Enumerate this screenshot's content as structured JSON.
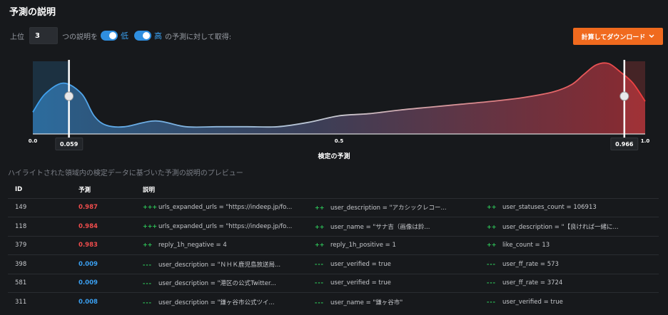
{
  "title": "予測の説明",
  "controls": {
    "prefix": "上位",
    "count_value": "3",
    "mid_text": "つの説明を",
    "low_label": "低",
    "high_label": "高",
    "suffix": "の予測に対して取得:",
    "download_label": "計算してダウンロード"
  },
  "chart_data": {
    "type": "area",
    "xlabel": "検定の予測",
    "xlim": [
      0,
      1
    ],
    "ticks": [
      "0.0",
      "0.5",
      "1.0"
    ],
    "low_threshold": 0.059,
    "high_threshold": 0.966,
    "low_threshold_label": "0.059",
    "high_threshold_label": "0.966",
    "x": [
      0,
      0.02,
      0.05,
      0.08,
      0.1,
      0.12,
      0.15,
      0.2,
      0.25,
      0.3,
      0.35,
      0.4,
      0.45,
      0.5,
      0.55,
      0.6,
      0.65,
      0.7,
      0.75,
      0.8,
      0.85,
      0.88,
      0.9,
      0.92,
      0.94,
      0.96,
      0.98,
      1.0
    ],
    "y": [
      0.3,
      0.55,
      0.7,
      0.55,
      0.25,
      0.12,
      0.1,
      0.18,
      0.1,
      0.1,
      0.1,
      0.1,
      0.16,
      0.25,
      0.28,
      0.33,
      0.37,
      0.41,
      0.45,
      0.5,
      0.58,
      0.68,
      0.82,
      0.95,
      0.97,
      0.85,
      0.7,
      0.45
    ]
  },
  "preview_note": "ハイライトされた領域内の検定データに基づいた予測の説明のプレビュー",
  "table": {
    "headers": [
      "ID",
      "予測",
      "説明"
    ],
    "rows": [
      {
        "id": "149",
        "pred": "0.987",
        "level": "high",
        "expl": [
          {
            "sign": "+++",
            "text": "urls_expanded_urls = \"https://indeep.jp/fo..."
          },
          {
            "sign": "++",
            "text": "user_description = \"アカシックレコー..."
          },
          {
            "sign": "++",
            "text": "user_statuses_count = 106913"
          }
        ]
      },
      {
        "id": "118",
        "pred": "0.984",
        "level": "high",
        "expl": [
          {
            "sign": "+++",
            "text": "urls_expanded_urls = \"https://indeep.jp/fo..."
          },
          {
            "sign": "++",
            "text": "user_name = \"サナ吉（画像は鈴..."
          },
          {
            "sign": "++",
            "text": "user_description = \"【良ければ一緒に..."
          }
        ]
      },
      {
        "id": "379",
        "pred": "0.983",
        "level": "high",
        "expl": [
          {
            "sign": "++",
            "text": "reply_1h_negative = 4"
          },
          {
            "sign": "++",
            "text": "reply_1h_positive = 1"
          },
          {
            "sign": "++",
            "text": "like_count = 13"
          }
        ]
      },
      {
        "id": "398",
        "pred": "0.009",
        "level": "low",
        "expl": [
          {
            "sign": "---",
            "text": "user_description = \"ＮＨＫ鹿児島放送局..."
          },
          {
            "sign": "---",
            "text": "user_verified = true"
          },
          {
            "sign": "---",
            "text": "user_ff_rate = 573"
          }
        ]
      },
      {
        "id": "581",
        "pred": "0.009",
        "level": "low",
        "expl": [
          {
            "sign": "---",
            "text": "user_description = \"港区の公式Twitter..."
          },
          {
            "sign": "---",
            "text": "user_verified = true"
          },
          {
            "sign": "---",
            "text": "user_ff_rate = 3724"
          }
        ]
      },
      {
        "id": "311",
        "pred": "0.008",
        "level": "low",
        "expl": [
          {
            "sign": "---",
            "text": "user_description = \"鎌ヶ谷市公式ツイ..."
          },
          {
            "sign": "---",
            "text": "user_name = \"鎌ヶ谷市\""
          },
          {
            "sign": "---",
            "text": "user_verified = true"
          }
        ]
      }
    ]
  },
  "colors": {
    "low": "#3a9ff0",
    "high": "#ef4c4c",
    "accent": "#f06a1e",
    "positive_sign": "#2ec85a"
  }
}
